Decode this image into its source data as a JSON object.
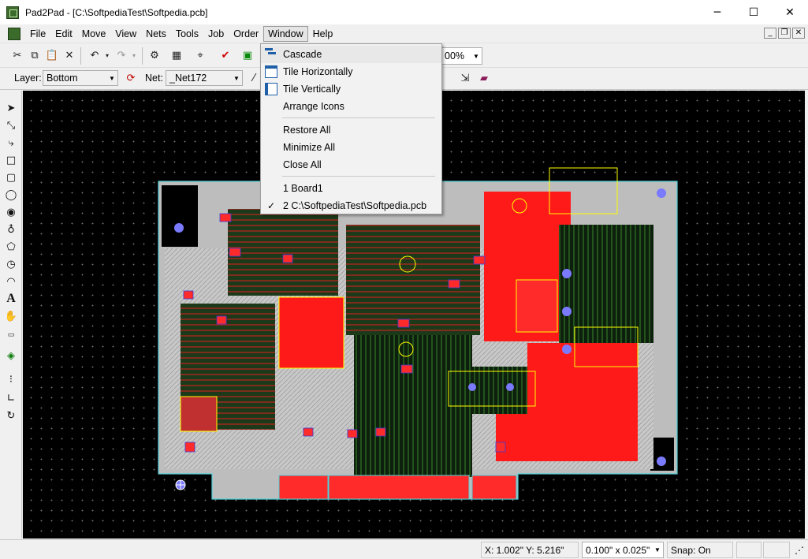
{
  "window": {
    "title": "Pad2Pad - [C:\\SoftpediaTest\\Softpedia.pcb]",
    "minimize": "─",
    "maximize": "☐",
    "close": "✕"
  },
  "menu": {
    "items": [
      {
        "id": "file",
        "label": "File"
      },
      {
        "id": "edit",
        "label": "Edit"
      },
      {
        "id": "move",
        "label": "Move"
      },
      {
        "id": "view",
        "label": "View"
      },
      {
        "id": "nets",
        "label": "Nets"
      },
      {
        "id": "tools",
        "label": "Tools"
      },
      {
        "id": "job",
        "label": "Job"
      },
      {
        "id": "order",
        "label": "Order"
      },
      {
        "id": "window",
        "label": "Window"
      },
      {
        "id": "help",
        "label": "Help"
      }
    ],
    "mdi": {
      "minimize": "_",
      "restore": "❐",
      "close": "✕"
    }
  },
  "toolbar": {
    "zoom": "00%",
    "layer_label": "Layer:",
    "layer_value": "Bottom",
    "net_label": "Net:",
    "net_value": "_Net172"
  },
  "window_menu": {
    "items": [
      {
        "label": "Cascade",
        "icon": "cascade-icon"
      },
      {
        "label": "Tile Horizontally",
        "icon": "tile-horizontal-icon"
      },
      {
        "label": "Tile Vertically",
        "icon": "tile-vertical-icon"
      },
      {
        "label": "Arrange Icons"
      },
      {
        "label": "Restore All"
      },
      {
        "label": "Minimize All"
      },
      {
        "label": "Close All"
      },
      {
        "label": "1 Board1"
      },
      {
        "label": "2 C:\\SoftpediaTest\\Softpedia.pcb",
        "checked": true
      }
    ],
    "check_glyph": "✓"
  },
  "status": {
    "coords": "X: 1.002\" Y: 5.216\"",
    "grid": "0.100\" x 0.025\"",
    "snap": "Snap: On"
  },
  "colors": {
    "copper_top": "#ff1a1a",
    "silkscreen": "#ffff00",
    "board_outline": "#4fd1d9",
    "pad": "#3a3ad8",
    "via_hole": "#7a7aff",
    "bottom_copper": "#2f6a2a",
    "board_fill": "#cfcfcf"
  }
}
